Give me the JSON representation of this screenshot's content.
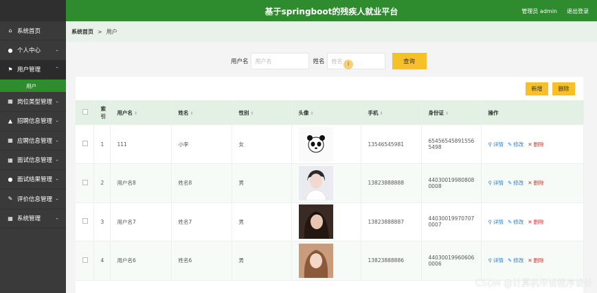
{
  "header": {
    "title": "基于springboot的残疾人就业平台",
    "admin_label": "管理员 admin",
    "logout_label": "退出登录"
  },
  "sidebar": {
    "items": [
      {
        "label": "系统首页",
        "icon": "home-icon"
      },
      {
        "label": "个人中心",
        "icon": "user-icon"
      },
      {
        "label": "用户管理",
        "icon": "flag-icon"
      },
      {
        "label": "岗位类型管理",
        "icon": "grid-icon"
      },
      {
        "label": "招聘信息管理",
        "icon": "thumbs-up-icon"
      },
      {
        "label": "应聘信息管理",
        "icon": "grid-icon"
      },
      {
        "label": "面试信息管理",
        "icon": "grid-icon"
      },
      {
        "label": "面试结果管理",
        "icon": "user-icon"
      },
      {
        "label": "评价信息管理",
        "icon": "edit-icon"
      },
      {
        "label": "系统管理",
        "icon": "grid-icon"
      }
    ],
    "subitem": "用户"
  },
  "breadcrumb": {
    "home": "系统首页",
    "sep": ">",
    "current": "用户"
  },
  "search": {
    "username_label": "用户名",
    "username_placeholder": "用户名",
    "name_label": "姓名",
    "name_placeholder": "姓名",
    "button": "查询"
  },
  "actions": {
    "add": "新增",
    "delete": "删除"
  },
  "table": {
    "headers": {
      "index": "索引",
      "username": "用户名",
      "name": "姓名",
      "gender": "性别",
      "avatar": "头像",
      "phone": "手机",
      "idcard": "身份证",
      "ops": "操作"
    },
    "op_labels": {
      "detail": "详情",
      "edit": "修改",
      "delete": "删除"
    },
    "rows": [
      {
        "index": "1",
        "username": "111",
        "name": "小李",
        "gender": "女",
        "phone": "13546545981",
        "idcard": "654565458915565498"
      },
      {
        "index": "2",
        "username": "用户名8",
        "name": "姓名8",
        "gender": "男",
        "phone": "13823888888",
        "idcard": "440300199808080008"
      },
      {
        "index": "3",
        "username": "用户名7",
        "name": "姓名7",
        "gender": "男",
        "phone": "13823888887",
        "idcard": "440300199707070007"
      },
      {
        "index": "4",
        "username": "用户名6",
        "name": "姓名6",
        "gender": "男",
        "phone": "13823888886",
        "idcard": "440300199606060006"
      }
    ]
  },
  "watermark": "CSDN @计算机毕设程序设计",
  "colors": {
    "primary_green": "#2e8b2e",
    "button_yellow": "#f6c02a",
    "sidebar_dark": "#3a3a3a",
    "delete_red": "#d9302c",
    "link_blue": "#2a7fc9"
  }
}
